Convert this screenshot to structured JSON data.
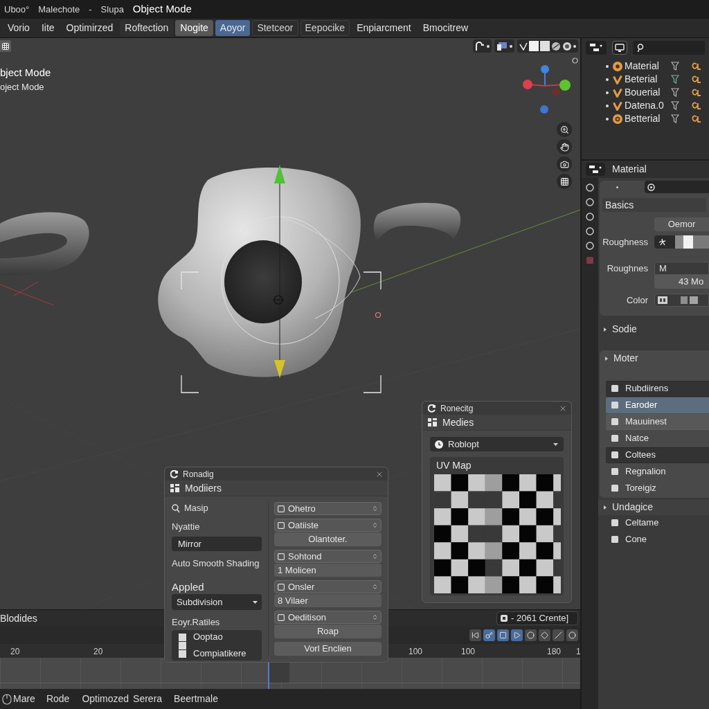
{
  "title_bar": {
    "items": [
      "Uboo°",
      "Malechote",
      "-",
      "Slupa"
    ],
    "mode": "Object Mode"
  },
  "menu_bar": [
    {
      "label": "Vorio",
      "kind": "plain",
      "selected": false
    },
    {
      "label": "Iite",
      "kind": "plain",
      "selected": false
    },
    {
      "label": "Optimirzed",
      "kind": "plain",
      "selected": false
    },
    {
      "label": "Roftection",
      "kind": "shaded",
      "selected": false
    },
    {
      "label": "Nogite",
      "kind": "pressed",
      "selected": false
    },
    {
      "label": "Aoyor",
      "kind": "plain",
      "selected": true
    },
    {
      "label": "Stetceor",
      "kind": "boxed",
      "selected": false
    },
    {
      "label": "Eepocike",
      "kind": "boxed",
      "selected": false
    },
    {
      "label": "Enpiarcment",
      "kind": "plain",
      "selected": false
    },
    {
      "label": "Bmocitrew",
      "kind": "plain",
      "selected": false
    }
  ],
  "viewport": {
    "mode_label": "bject Mode",
    "sub_label": "oject Mode"
  },
  "outliner": {
    "rows": [
      {
        "name": "Material",
        "kind": "ring"
      },
      {
        "name": "Beterial",
        "kind": "check"
      },
      {
        "name": "Bouerial",
        "kind": "check"
      },
      {
        "name": "Datena.0",
        "kind": "check"
      },
      {
        "name": "Betterial",
        "kind": "gear"
      }
    ]
  },
  "properties": {
    "title": "Material",
    "basics": {
      "title": "Basics",
      "fields": [
        {
          "kind": "button",
          "value": "Oemor"
        },
        {
          "kind": "ramp",
          "label": "Roughness"
        },
        {
          "kind": "text",
          "label": "Roughnes",
          "value": "M"
        },
        {
          "kind": "number",
          "value": "43 Mo"
        },
        {
          "kind": "color",
          "label": "Color"
        }
      ]
    },
    "sections": [
      {
        "title": "Sodie",
        "kind": "header"
      },
      {
        "title": "Moter",
        "kind": "panel",
        "items": [
          {
            "label": "Rubdiirens",
            "kind": "dark",
            "selected": false
          },
          {
            "label": "Earoder",
            "kind": "plain",
            "selected": true
          },
          {
            "label": "Mauuinest",
            "kind": "light",
            "selected": false
          },
          {
            "label": "Natce",
            "kind": "plain",
            "selected": false
          },
          {
            "label": "Coltees",
            "kind": "dark",
            "selected": false
          },
          {
            "label": "Regnalion",
            "kind": "plain",
            "selected": false
          },
          {
            "label": "Toreigiz",
            "kind": "plain",
            "selected": false
          }
        ]
      },
      {
        "title": "Undagice",
        "kind": "list",
        "items": [
          {
            "label": "Celtame",
            "kind": "plain",
            "selected": false
          },
          {
            "label": "Cone",
            "kind": "plain",
            "selected": false
          }
        ]
      }
    ]
  },
  "timeline": {
    "title": "Blodides",
    "frame_label": "- 2061 Crente]",
    "toggles": [
      {
        "on": false
      },
      {
        "on": true
      },
      {
        "on": true
      },
      {
        "on": true
      },
      {
        "on": false
      },
      {
        "on": false
      },
      {
        "on": false
      },
      {
        "on": false
      }
    ],
    "ruler": [
      "20",
      "20",
      "100",
      "100",
      "180",
      "1"
    ],
    "playhead": {
      "level": 0.462
    }
  },
  "status_bar": [
    "Mare",
    "Rode",
    "Optimozed",
    "Serera",
    "Beertmale"
  ],
  "modifier_panel": {
    "title": "Ronadig",
    "header": "Modiiers",
    "left": [
      {
        "kind": "icon_label",
        "text": "Masip"
      },
      {
        "kind": "label",
        "text": "Nyattie"
      },
      {
        "kind": "field",
        "text": "Mirror"
      },
      {
        "kind": "label",
        "text": "Auto Smooth Shading"
      },
      {
        "kind": "heading",
        "text": "Appled"
      },
      {
        "kind": "dropdown",
        "text": "Subdivision"
      },
      {
        "kind": "label",
        "text": "Eoyr.Ratiles"
      }
    ],
    "list": [
      {
        "label": "Ooptao",
        "checked": false
      },
      {
        "checked": false
      },
      {
        "label": "Compiatikere",
        "checked": false
      }
    ],
    "right": [
      {
        "items": [
          {
            "kind": "dropdown",
            "text": "Ohetro"
          }
        ]
      },
      {
        "items": [
          {
            "kind": "dropdown",
            "text": "Oatiiste"
          },
          {
            "kind": "button",
            "text": "Olantoter."
          }
        ]
      },
      {
        "items": [
          {
            "kind": "dropdown",
            "text": "Sohtond"
          },
          {
            "kind": "field",
            "text": "1 Molicen"
          }
        ]
      },
      {
        "items": [
          {
            "kind": "dropdown",
            "text": "Onsler"
          },
          {
            "kind": "field",
            "text": "8 Vilaer"
          }
        ]
      },
      {
        "items": [
          {
            "kind": "dropdown",
            "text": "Oeditison"
          },
          {
            "kind": "button",
            "text": "Roap"
          }
        ]
      },
      {
        "items": [
          {
            "kind": "button",
            "text": "Vorl Enclien"
          }
        ]
      }
    ]
  },
  "uv_panel": {
    "title": "Ronecitg",
    "header": "Medies",
    "dropdown": "Roblopt",
    "map_title": "UV Map"
  }
}
